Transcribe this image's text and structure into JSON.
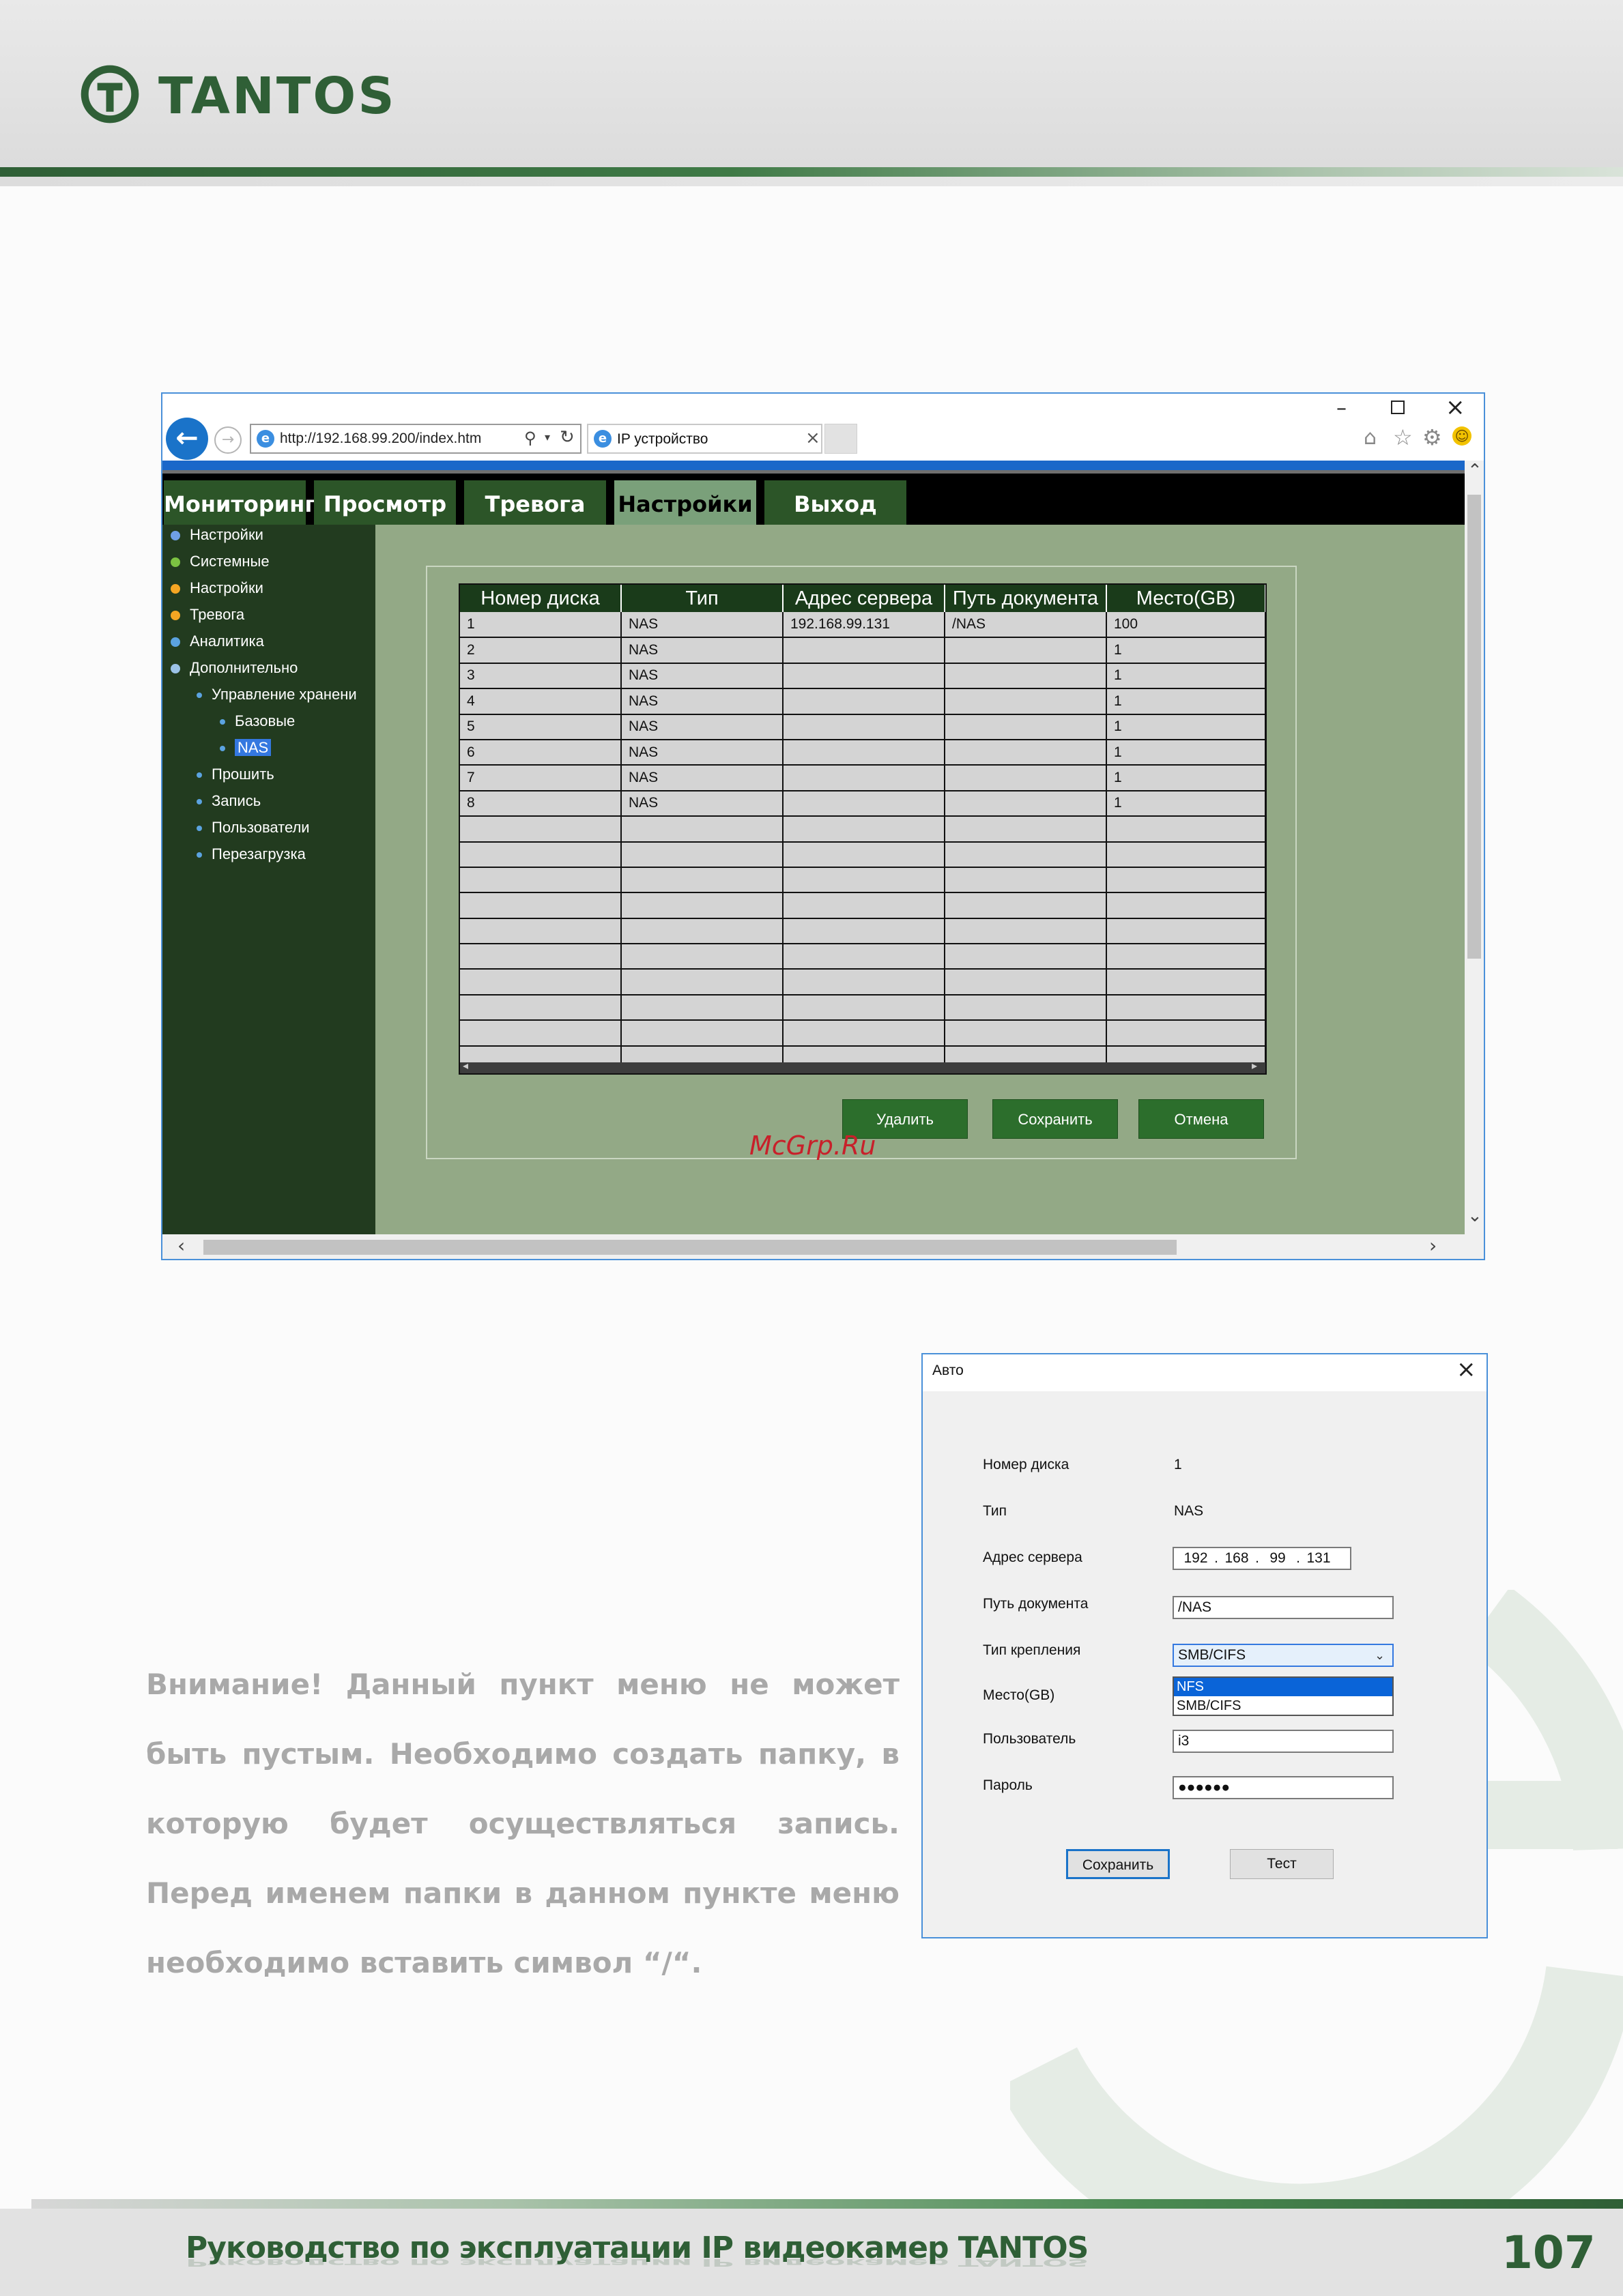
{
  "header": {
    "brand": "TANTOS"
  },
  "browser": {
    "url": "http://192.168.99.200/index.htm",
    "tab_title": "IP устройство"
  },
  "nav": {
    "tabs": [
      "Мониторинг",
      "Просмотр",
      "Тревога",
      "Настройки",
      "Выход"
    ],
    "active": "Настройки"
  },
  "sidebar": {
    "items": [
      {
        "label": "Настройки",
        "color": "#6fa0e6",
        "level": 0
      },
      {
        "label": "Системные",
        "color": "#7cc242",
        "level": 0
      },
      {
        "label": "Настройки",
        "color": "#f5a623",
        "level": 0
      },
      {
        "label": "Тревога",
        "color": "#f5a623",
        "level": 0
      },
      {
        "label": "Аналитика",
        "color": "#5ba3e0",
        "level": 0
      },
      {
        "label": "Дополнительно",
        "color": "#9bc2e6",
        "level": 0
      },
      {
        "label": "Управление хранени",
        "level": 1
      },
      {
        "label": "Базовые",
        "level": 2
      },
      {
        "label": "NAS",
        "level": 2,
        "selected": true
      },
      {
        "label": "Прошить",
        "level": 1
      },
      {
        "label": "Запись",
        "level": 1
      },
      {
        "label": "Пользователи",
        "level": 1
      },
      {
        "label": "Перезагрузка",
        "level": 1
      }
    ]
  },
  "table": {
    "headers": [
      "Номер диска",
      "Тип",
      "Адрес сервера",
      "Путь документа",
      "Место(GB)"
    ],
    "rows": [
      [
        "1",
        "NAS",
        "192.168.99.131",
        "/NAS",
        "100"
      ],
      [
        "2",
        "NAS",
        "",
        "",
        "1"
      ],
      [
        "3",
        "NAS",
        "",
        "",
        "1"
      ],
      [
        "4",
        "NAS",
        "",
        "",
        "1"
      ],
      [
        "5",
        "NAS",
        "",
        "",
        "1"
      ],
      [
        "6",
        "NAS",
        "",
        "",
        "1"
      ],
      [
        "7",
        "NAS",
        "",
        "",
        "1"
      ],
      [
        "8",
        "NAS",
        "",
        "",
        "1"
      ]
    ],
    "empty_rows": 10
  },
  "buttons": {
    "delete": "Удалить",
    "save": "Сохранить",
    "cancel": "Отмена"
  },
  "watermark_text": "McGrp.Ru",
  "dialog": {
    "title": "Авто",
    "labels": {
      "disk": "Номер диска",
      "type": "Тип",
      "server": "Адрес сервера",
      "path": "Путь документа",
      "mount": "Тип крепления",
      "space": "Место(GB)",
      "user": "Пользователь",
      "password": "Пароль"
    },
    "values": {
      "disk": "1",
      "type": "NAS",
      "ip": [
        "192",
        "168",
        "99",
        "131"
      ],
      "path": "/NAS",
      "mount": "SMB/CIFS",
      "user": "i3",
      "password": "●●●●●●"
    },
    "mount_options": [
      "NFS",
      "SMB/CIFS"
    ],
    "buttons": {
      "save": "Сохранить",
      "test": "Тест"
    }
  },
  "notice": "Внимание! Данный пункт меню не может быть пустым. Необходимо создать папку, в которую будет осуществляться запись. Перед именем папки в данном пункте меню необходимо вставить символ “/“.",
  "footer": {
    "title": "Руководство по эксплуатации IP видеокамер TANTOS",
    "page_number": "107"
  }
}
